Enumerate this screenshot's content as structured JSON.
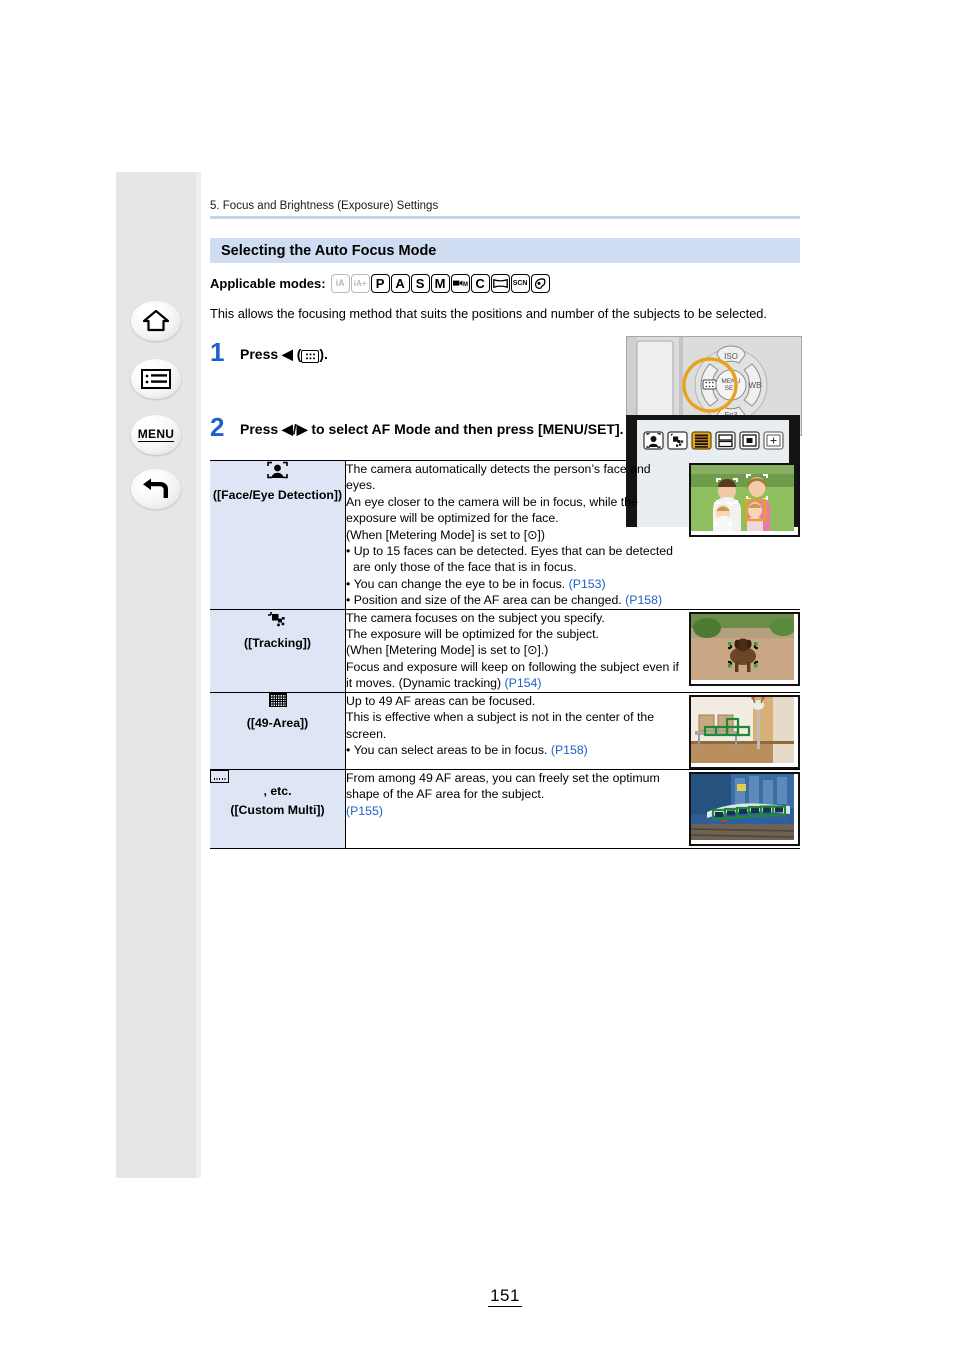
{
  "sidebar": {
    "buttons": [
      {
        "name": "home",
        "label": "Home"
      },
      {
        "name": "contents",
        "label": "Contents"
      },
      {
        "name": "menu",
        "label": "MENU"
      },
      {
        "name": "back",
        "label": "Back"
      }
    ]
  },
  "header": {
    "breadcrumb": "5. Focus and Brightness (Exposure) Settings",
    "section_title": "Selecting the Auto Focus Mode"
  },
  "applicable": {
    "label": "Applicable modes:",
    "modes": [
      {
        "id": "ia",
        "glyph": "iA",
        "enabled": false
      },
      {
        "id": "ia-plus",
        "glyph": "iA+",
        "enabled": false
      },
      {
        "id": "p",
        "glyph": "P",
        "enabled": true
      },
      {
        "id": "a",
        "glyph": "A",
        "enabled": true
      },
      {
        "id": "s",
        "glyph": "S",
        "enabled": true
      },
      {
        "id": "m",
        "glyph": "M",
        "enabled": true
      },
      {
        "id": "creative-video",
        "glyph": "M",
        "enabled": true
      },
      {
        "id": "c",
        "glyph": "C",
        "enabled": true
      },
      {
        "id": "panorama",
        "glyph": "",
        "enabled": true
      },
      {
        "id": "scn",
        "glyph": "SCN",
        "enabled": true
      },
      {
        "id": "creative-control",
        "glyph": "",
        "enabled": true
      }
    ]
  },
  "intro": "This allows the focusing method that suits the positions and number of the subjects to be selected.",
  "steps": [
    {
      "number": "1",
      "text_before": "Press ◀ (",
      "icon": "af-mode-icon",
      "text_after": ").",
      "figure": "camera-rear-cursor-button-photo"
    },
    {
      "number": "2",
      "text": "Press ◀/▶ to select AF Mode and then press [MENU/SET].",
      "figure": "af-mode-selection-bar-screen",
      "screen_icons": [
        {
          "id": "face-eye-detection",
          "selected": false
        },
        {
          "id": "tracking",
          "selected": false
        },
        {
          "id": "49-area",
          "selected": true
        },
        {
          "id": "custom-multi",
          "selected": false
        },
        {
          "id": "1-area",
          "selected": false
        },
        {
          "id": "pinpoint",
          "selected": false
        }
      ]
    }
  ],
  "table": {
    "rows": [
      {
        "icon_name": "face-eye-detection-icon",
        "icon_label": "([Face/Eye Detection])",
        "lines": [
          "The camera automatically detects the person’s face and eyes.",
          "An eye closer to the camera will be in focus, while the exposure will be optimized for the face.",
          "(When [Metering Mode] is set to [⊙])"
        ],
        "bullets": [
          {
            "text": "Up to 15 faces can be detected. Eyes that can be detected are only those of the face that is in focus.",
            "ref": ""
          },
          {
            "text": "You can change the eye to be in focus.",
            "ref": "(P153)"
          },
          {
            "text": "Position and size of the AF area can be changed.",
            "ref": "(P158)"
          }
        ],
        "thumb": "family-portrait-with-face-detection-frames"
      },
      {
        "icon_name": "tracking-icon",
        "icon_label": "([Tracking])",
        "lines": [
          "The camera focuses on the subject you specify.",
          "The exposure will be optimized for the subject.",
          "(When [Metering Mode] is set to [⊙].)",
          "Focus and exposure will keep on following the subject even if it moves. (Dynamic tracking)"
        ],
        "inline_ref": "(P154)",
        "bullets": [],
        "thumb": "dog-on-path-with-tracking-frame"
      },
      {
        "icon_name": "49-area-icon",
        "icon_label": "([49-Area])",
        "lines": [
          "Up to 49 AF areas can be focused.",
          "This is effective when a subject is not in the center of the screen."
        ],
        "bullets": [
          {
            "text": "You can select areas to be in focus.",
            "ref": "(P158)"
          }
        ],
        "thumb": "interior-chairs-with-green-af-areas"
      },
      {
        "icon_name": "custom-multi-icon",
        "icon_label_prefix": ", etc.",
        "icon_label": "([Custom Multi])",
        "lines": [
          "From among 49 AF areas, you can freely set the optimum shape of the AF area for the subject."
        ],
        "inline_ref": "(P155)",
        "bullets": [],
        "thumb": "train-with-horizontal-green-af-areas"
      }
    ]
  },
  "footer": {
    "next_page_icon": "next-page-down-arrow",
    "page_number": "151"
  },
  "colors": {
    "accent_blue": "#1f5fd0",
    "band_blue": "#cfdcf1",
    "cell_blue": "#dee6f5",
    "link_blue": "#2060c8",
    "highlight_orange": "#e8a31d"
  }
}
